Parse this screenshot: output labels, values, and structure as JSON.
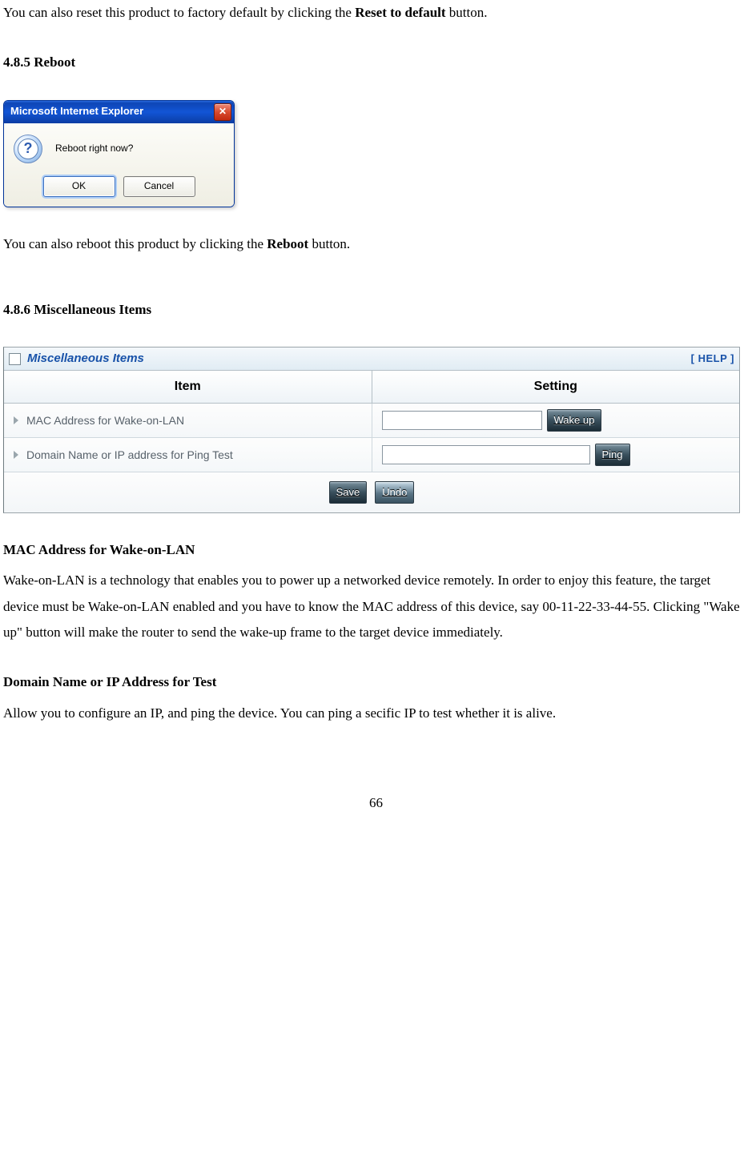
{
  "intro": {
    "reset_pre": "You can also reset this product to factory default by clicking the ",
    "reset_bold": "Reset to default",
    "reset_post": " button."
  },
  "section_reboot": {
    "heading": "4.8.5 Reboot",
    "dialog": {
      "title": "Microsoft Internet Explorer",
      "close_glyph": "✕",
      "help_glyph": "?",
      "message": "Reboot right now?",
      "ok_label": "OK",
      "cancel_label": "Cancel"
    },
    "note_pre": "You can also reboot this product by clicking the ",
    "note_bold": "Reboot",
    "note_post": " button."
  },
  "section_misc": {
    "heading": "4.8.6 Miscellaneous Items",
    "panel": {
      "toggle_glyph": "□",
      "title": "Miscellaneous Items",
      "help_label": "[ HELP ]",
      "columns": {
        "item": "Item",
        "setting": "Setting"
      },
      "rows": [
        {
          "label": "MAC Address for Wake-on-LAN",
          "input_value": "",
          "button_label": "Wake up"
        },
        {
          "label": "Domain Name or IP address for Ping Test",
          "input_value": "",
          "button_label": "Ping"
        }
      ],
      "footer": {
        "save_label": "Save",
        "undo_label": "Undo"
      }
    }
  },
  "descriptions": {
    "mac_heading": "MAC Address for Wake-on-LAN",
    "mac_body": "Wake-on-LAN is a technology that enables you to power up a networked device remotely. In order to enjoy this feature, the target device must be Wake-on-LAN enabled and you have to know the MAC address of this device, say 00-11-22-33-44-55. Clicking \"Wake up\" button will make the router to send the wake-up frame to the target device immediately.",
    "domain_heading": "Domain Name or IP Address for Test",
    "domain_body": "Allow you to configure an IP, and ping the device. You can ping a secific IP to test whether it is alive."
  },
  "page_number": "66"
}
